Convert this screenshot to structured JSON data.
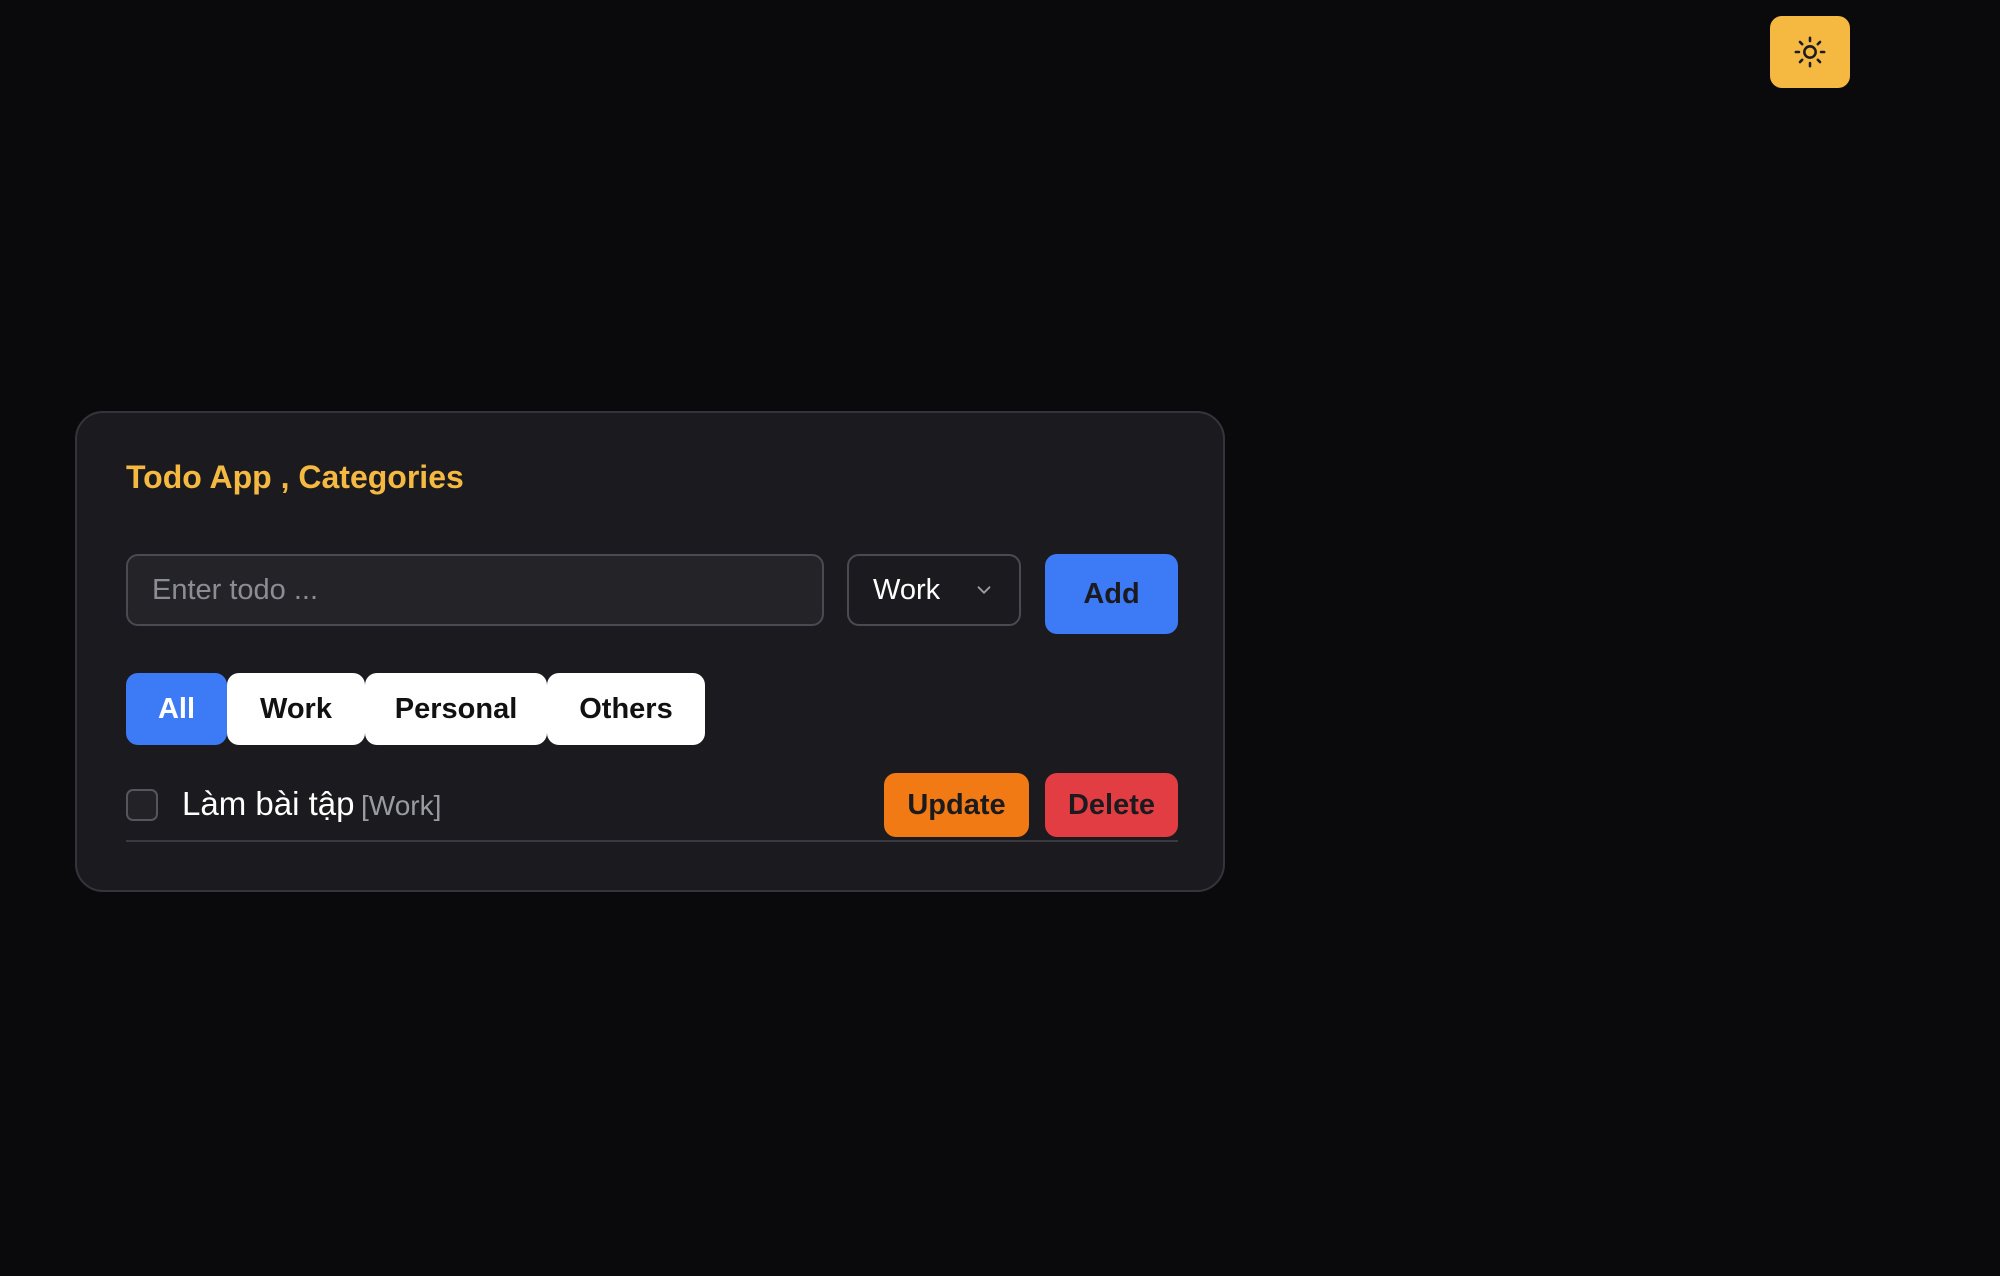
{
  "theme": {
    "page_background": "#0a0a0c",
    "card_background": "#1b1b1f",
    "title_color": "#f5b942",
    "text_color": "#ffffff",
    "muted_text_color": "#9a9ba2",
    "toggle_background": "#f5b942",
    "toggle_icon_color": "#1b1b1f",
    "add_button_background": "#3d7bf6",
    "add_button_text": "#1b1b1f",
    "active_tab_background": "#3d7bf6",
    "active_tab_text": "#ffffff",
    "inactive_tab_background": "#ffffff",
    "inactive_tab_text": "#111111",
    "update_button_background": "#f17a14",
    "update_button_text": "#1b1b1f",
    "delete_button_background": "#e23d42",
    "delete_button_text": "#1b1b1f"
  },
  "header": {
    "theme_toggle_icon": "sun-icon"
  },
  "card": {
    "title": "Todo App , Categories"
  },
  "form": {
    "input_value": "",
    "input_placeholder": "Enter todo ...",
    "select_value": "Work",
    "select_icon": "chevron-down-icon",
    "add_label": "Add"
  },
  "filters": {
    "active": "All",
    "items": [
      {
        "label": "All"
      },
      {
        "label": "Work"
      },
      {
        "label": "Personal"
      },
      {
        "label": "Others"
      }
    ]
  },
  "todos": [
    {
      "text": "Làm bài tập",
      "category": "[Work]",
      "checked": false,
      "update_label": "Update",
      "delete_label": "Delete"
    }
  ]
}
